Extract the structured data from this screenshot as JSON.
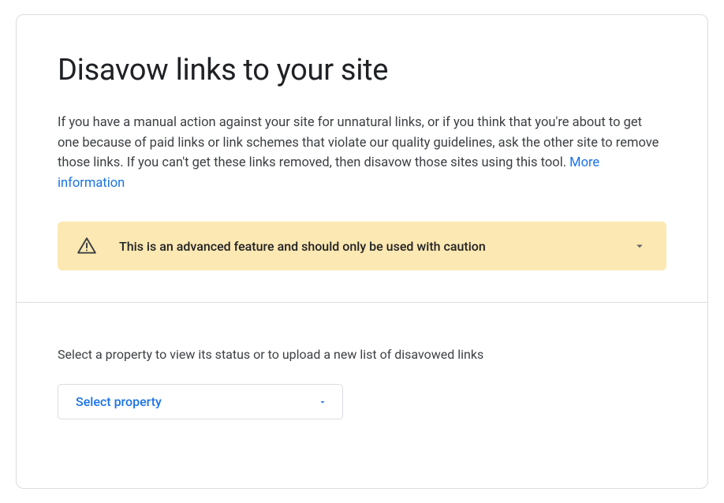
{
  "header": {
    "title": "Disavow links to your site",
    "description": "If you have a manual action against your site for unnatural links, or if you think that you're about to get one because of paid links or link schemes that violate our quality guidelines, ask the other site to remove those links. If you can't get these links removed, then disavow those sites using this tool. ",
    "more_info_label": "More information"
  },
  "warning": {
    "text": "This is an advanced feature and should only be used with caution"
  },
  "property_section": {
    "label": "Select a property to view its status or to upload a new list of disavowed links",
    "select_placeholder": "Select property"
  }
}
